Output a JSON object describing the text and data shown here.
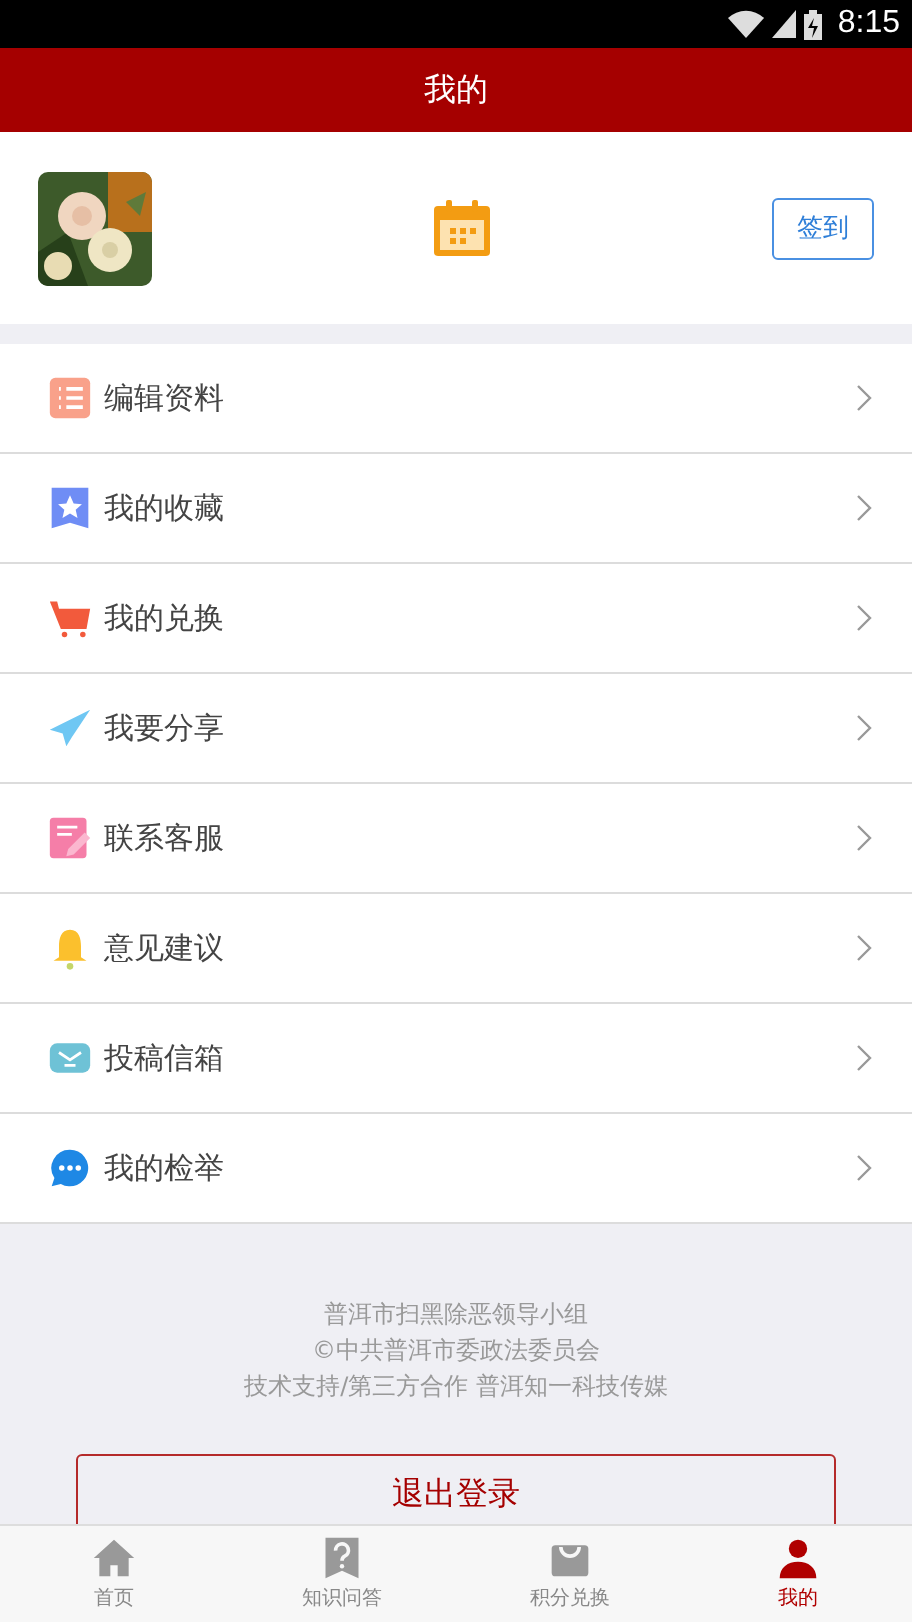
{
  "status_bar": {
    "time": "8:15"
  },
  "header": {
    "title": "我的"
  },
  "profile": {
    "checkin_button": "签到"
  },
  "menu": [
    {
      "label": "编辑资料"
    },
    {
      "label": "我的收藏"
    },
    {
      "label": "我的兑换"
    },
    {
      "label": "我要分享"
    },
    {
      "label": "联系客服"
    },
    {
      "label": "意见建议"
    },
    {
      "label": "投稿信箱"
    },
    {
      "label": "我的检举"
    }
  ],
  "footer": {
    "lines": [
      "普洱市扫黑除恶领导小组",
      "©中共普洱市委政法委员会",
      "技术支持/第三方合作 普洱知一科技传媒"
    ],
    "logout_button": "退出登录"
  },
  "tab_bar": [
    {
      "label": "首页",
      "selected": false
    },
    {
      "label": "知识问答",
      "selected": false
    },
    {
      "label": "积分兑换",
      "selected": false
    },
    {
      "label": "我的",
      "selected": true
    }
  ]
}
